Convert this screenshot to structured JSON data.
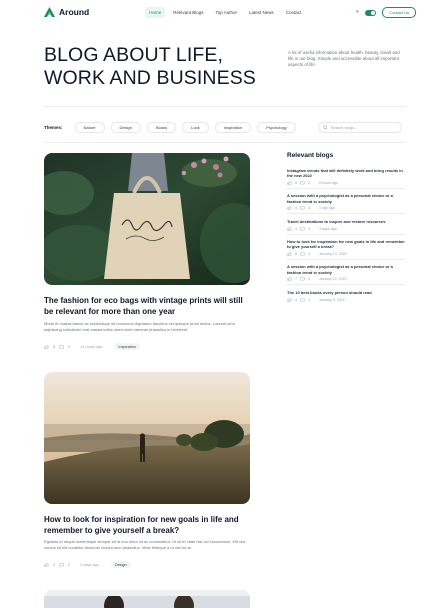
{
  "brand": {
    "name": "Around",
    "accent": "#1f8a64"
  },
  "nav": {
    "items": [
      {
        "label": "Home",
        "active": true
      },
      {
        "label": "Relevant Blogs",
        "active": false
      },
      {
        "label": "Top Author",
        "active": false
      },
      {
        "label": "Latest News",
        "active": false
      },
      {
        "label": "Contact",
        "active": false
      }
    ],
    "theme_toggle_icon": "sun-icon",
    "theme_toggle_on": true,
    "contact_button": "Contact Us"
  },
  "hero": {
    "title_line1": "BLOG ABOUT LIFE,",
    "title_line2": "WORK AND BUSINESS",
    "description": "A lot of useful information about health, beauty, travel and life in our blog. Simple and accessible about all important aspects of life."
  },
  "themes": {
    "label": "Themes:",
    "chips": [
      "Nature",
      "Design",
      "Books",
      "Look",
      "Inspiration",
      "Psychology"
    ]
  },
  "search": {
    "placeholder": "Search blogs...",
    "icon": "search-icon"
  },
  "articles": [
    {
      "title": "The fashion for eco bags with vintage prints will still be relevant for more than one year",
      "excerpt": "Morbi et massa fames ac scelerisque sit commodo dignissim faucibus vel quisque proin lectus. Laoreet sem adipiscing sollicitudin erat massa tellus lorem enim aenean phasellus in hendrerit.",
      "likes": "8",
      "comments": "0",
      "time": "12 hours ago",
      "tag": "Inspiration",
      "image": "tote-bag-photo"
    },
    {
      "title": "How to look for inspiration for new goals in life and remember to give yourself a break?",
      "excerpt": "Egestas in neque scelerisque semper sit id non dolor sit ac consectetur. Ut sit et vitae nisl dui consectetur. Elit nisl cursus sit elit curabitur dictumst viverra sem phasellus. Vitae tristique a ut nisl mi at.",
      "likes": "0",
      "comments": "0",
      "time": "2 days ago",
      "tag": "Design",
      "image": "sunset-hill-photo"
    }
  ],
  "sidebar": {
    "title": "Relevant blogs",
    "items": [
      {
        "title": "Instagram trends that will definitely work and bring results in the new 2022",
        "likes": "5",
        "comments": "2",
        "date": "8 hours ago"
      },
      {
        "title": "A session with a psychologist as a personal choice or a fashion trend in society",
        "likes": "4",
        "comments": "4",
        "date": "1 day ago"
      },
      {
        "title": "Travel destinations to inspire and restore resources",
        "likes": "4",
        "comments": "5",
        "date": "3 days ago"
      },
      {
        "title": "How to look for inspiration for new goals in life and remember to give yourself a break?",
        "likes": "8",
        "comments": "4",
        "date": "January 13, 2022"
      },
      {
        "title": "A session with a psychologist as a personal choice or a fashion trend in society",
        "likes": "7",
        "comments": "4",
        "date": "January 12, 2022"
      },
      {
        "title": "The 10 best books every person should read",
        "likes": "4",
        "comments": "4",
        "date": "January 9, 2022"
      }
    ]
  }
}
